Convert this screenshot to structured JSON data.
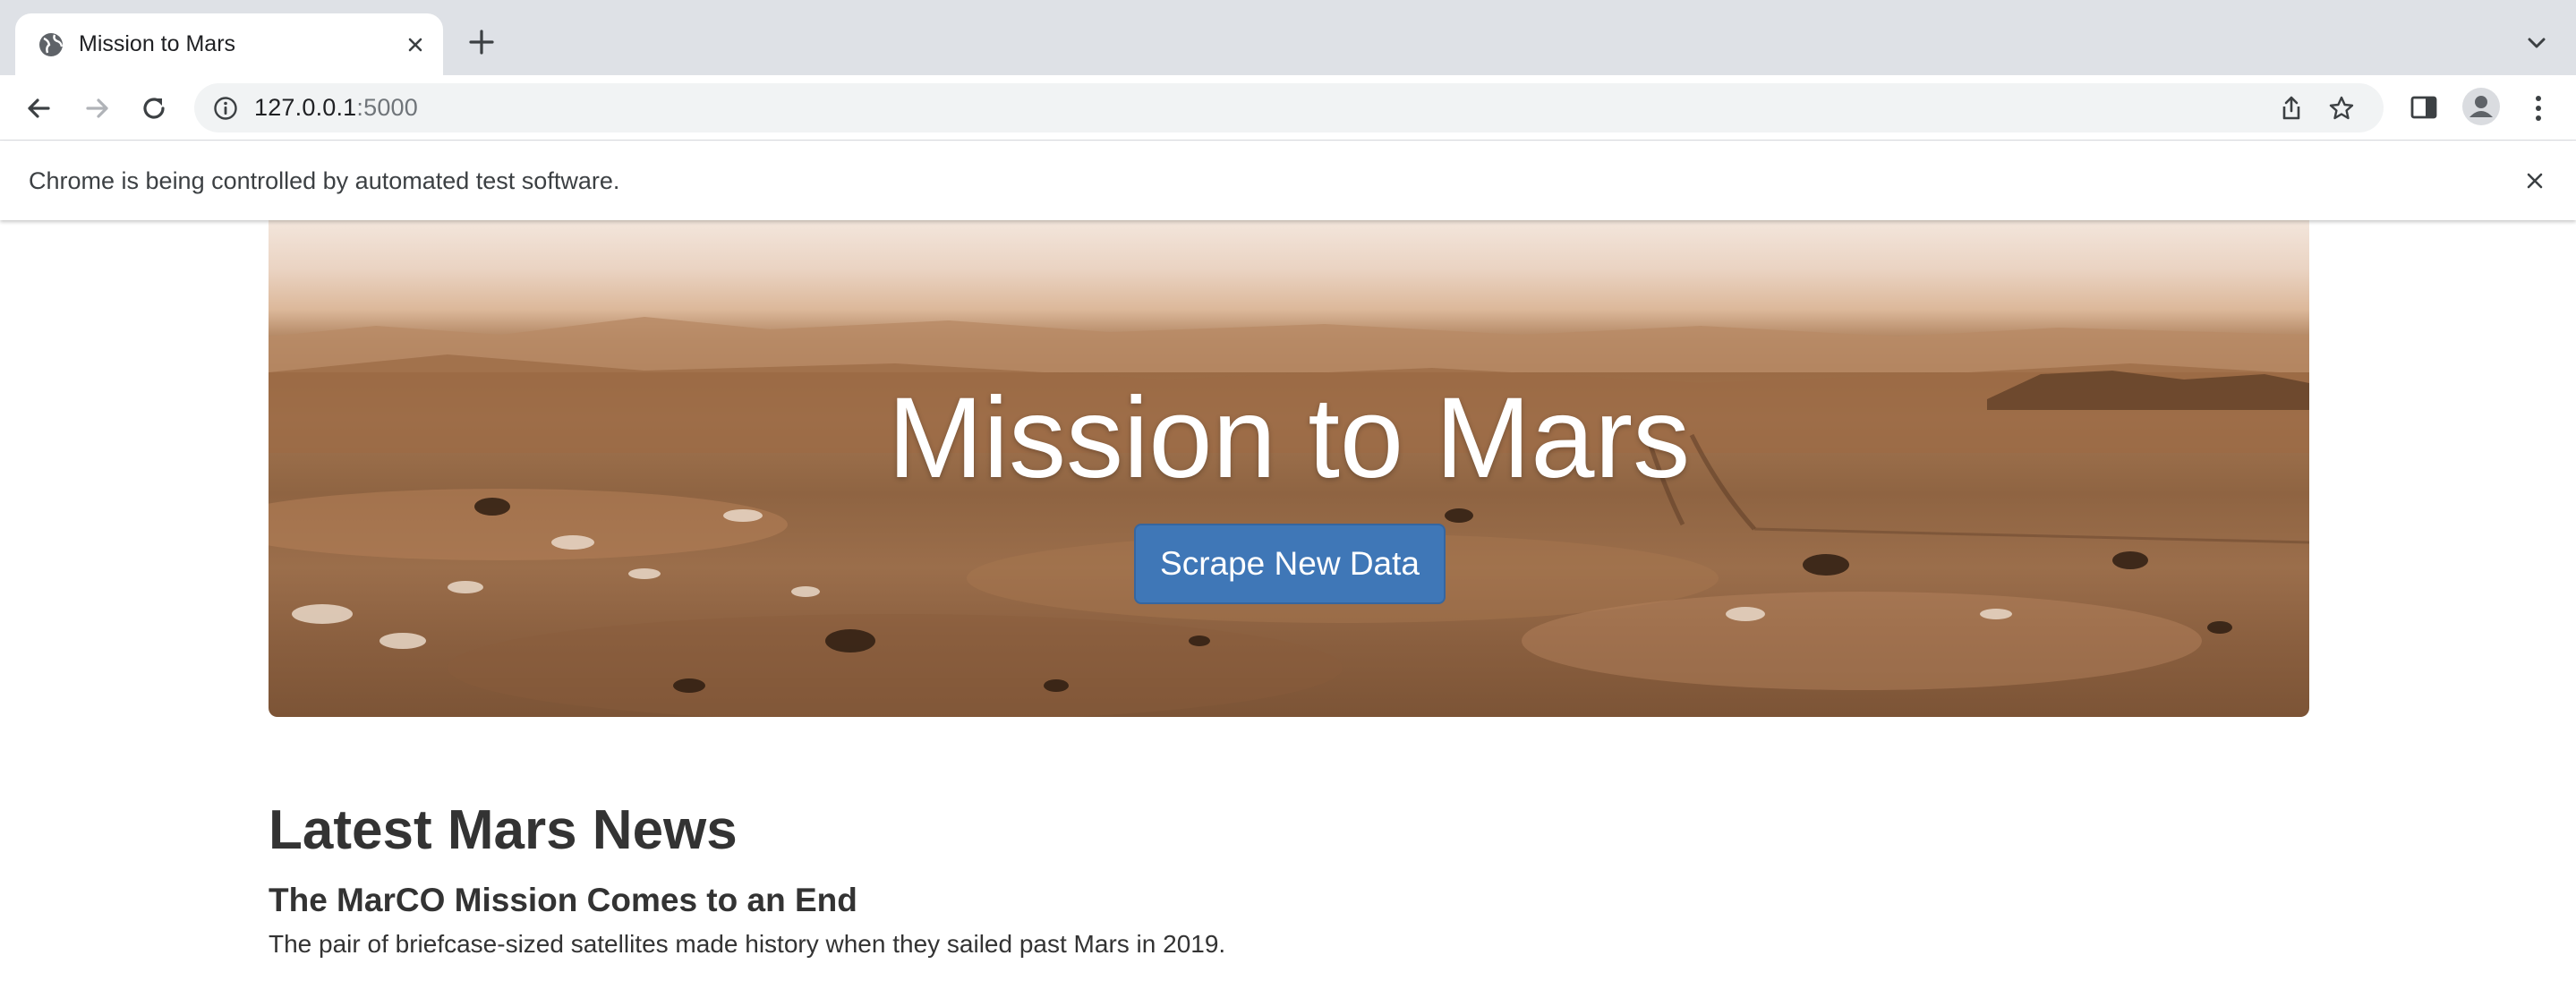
{
  "browser": {
    "tab": {
      "title": "Mission to Mars",
      "favicon": "globe-icon"
    },
    "address": {
      "host": "127.0.0.1",
      "port": ":5000"
    },
    "infobar": {
      "text": "Chrome is being controlled by automated test software."
    }
  },
  "page": {
    "jumbotron": {
      "title": "Mission to Mars",
      "button_label": "Scrape New Data"
    },
    "news": {
      "heading": "Latest Mars News",
      "title": "The MarCO Mission Comes to an End",
      "teaser": "The pair of briefcase-sized satellites made history when they sailed past Mars in 2019."
    }
  },
  "colors": {
    "button": "#3f77b7",
    "tabstrip": "#dee1e6",
    "text": "#333333"
  }
}
